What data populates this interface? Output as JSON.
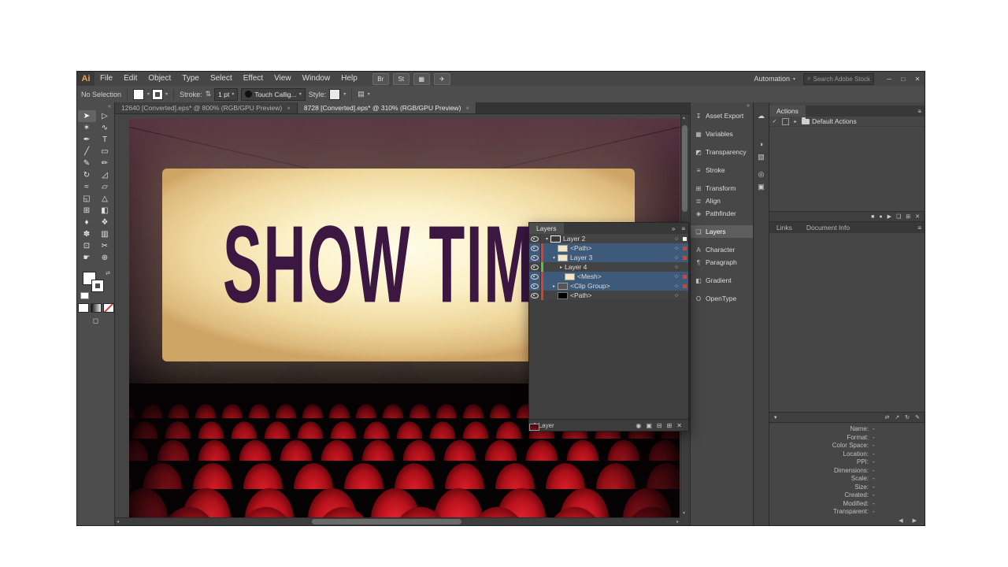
{
  "ui": {
    "caret": "▾",
    "collapse_left": "«",
    "collapse_right": "»",
    "panel_menu": "≡",
    "target": "○",
    "up": "▴",
    "down": "▾",
    "left": "◂",
    "right": "▸",
    "swap": "⇄",
    "stepper": "⇅",
    "search_glyph": "⊕"
  },
  "window": {
    "logo": "Ai",
    "menus": [
      {
        "label": "File"
      },
      {
        "label": "Edit"
      },
      {
        "label": "Object"
      },
      {
        "label": "Type"
      },
      {
        "label": "Select"
      },
      {
        "label": "Effect"
      },
      {
        "label": "View"
      },
      {
        "label": "Window"
      },
      {
        "label": "Help"
      }
    ],
    "menubar_icons": [
      {
        "name": "bridge-icon",
        "glyph": "Br"
      },
      {
        "name": "stock-icon",
        "glyph": "St"
      },
      {
        "name": "arrange-documents-icon",
        "glyph": "▦"
      },
      {
        "name": "gpu-performance-icon",
        "glyph": "✈"
      }
    ],
    "workspace": {
      "label": "Automation"
    },
    "search": {
      "placeholder": "Search Adobe Stock"
    },
    "window_controls": [
      {
        "name": "minimize-button",
        "glyph": "─"
      },
      {
        "name": "restore-button",
        "glyph": "□"
      },
      {
        "name": "close-button",
        "glyph": "✕"
      }
    ]
  },
  "control_bar": {
    "selection_status": "No Selection",
    "stroke_label": "Stroke:",
    "stroke_value": "1 pt",
    "brush_value": "Touch Callig...",
    "style_label": "Style:",
    "extra_icon": "▤"
  },
  "document_tabs": [
    {
      "label": "12640 [Converted].eps* @ 800% (RGB/GPU Preview)",
      "close": "×",
      "active": false
    },
    {
      "label": "8728 [Converted].eps* @ 310% (RGB/GPU Preview)",
      "close": "×",
      "active": true
    }
  ],
  "tools": [
    {
      "name": "selection-tool",
      "glyph": "➤",
      "active": true
    },
    {
      "name": "direct-selection-tool",
      "glyph": "▷"
    },
    {
      "name": "magic-wand-tool",
      "glyph": "✶"
    },
    {
      "name": "lasso-tool",
      "glyph": "∿"
    },
    {
      "name": "pen-tool",
      "glyph": "✒"
    },
    {
      "name": "type-tool",
      "glyph": "T"
    },
    {
      "name": "line-segment-tool",
      "glyph": "╱"
    },
    {
      "name": "rectangle-tool",
      "glyph": "▭"
    },
    {
      "name": "paintbrush-tool",
      "glyph": "✎"
    },
    {
      "name": "pencil-tool",
      "glyph": "✏"
    },
    {
      "name": "rotate-tool",
      "glyph": "↻"
    },
    {
      "name": "scale-tool",
      "glyph": "◿"
    },
    {
      "name": "width-tool",
      "glyph": "≈"
    },
    {
      "name": "free-transform-tool",
      "glyph": "▱"
    },
    {
      "name": "shape-builder-tool",
      "glyph": "◱"
    },
    {
      "name": "perspective-grid-tool",
      "glyph": "△"
    },
    {
      "name": "mesh-tool",
      "glyph": "⊞"
    },
    {
      "name": "gradient-tool",
      "glyph": "◧"
    },
    {
      "name": "eyedropper-tool",
      "glyph": "♦"
    },
    {
      "name": "blend-tool",
      "glyph": "❖"
    },
    {
      "name": "symbol-sprayer-tool",
      "glyph": "✽"
    },
    {
      "name": "column-graph-tool",
      "glyph": "▥"
    },
    {
      "name": "artboard-tool",
      "glyph": "⊡"
    },
    {
      "name": "slice-tool",
      "glyph": "✂"
    },
    {
      "name": "hand-tool",
      "glyph": "☛"
    },
    {
      "name": "zoom-tool",
      "glyph": "⊕"
    }
  ],
  "tool_footer": {
    "screen_mode_icon": "◻"
  },
  "canvas": {
    "screen_text": "SHOW TIME"
  },
  "layers_panel": {
    "tab": "Layers",
    "header_icons": [
      {
        "name": "panel-collapse-icon",
        "glyph": "»"
      },
      {
        "name": "panel-menu-icon",
        "glyph": "≡"
      }
    ],
    "rows": [
      {
        "name": "Layer 2",
        "chevron": "▾",
        "indent": 0,
        "bar": "",
        "thumb": "artboard",
        "selected": false,
        "indicator": "white"
      },
      {
        "name": "<Path>",
        "chevron": "",
        "indent": 1,
        "bar": "red",
        "thumb": "light",
        "selected": true,
        "indicator": "red"
      },
      {
        "name": "Layer 3",
        "chevron": "▾",
        "indent": 1,
        "bar": "red",
        "thumb": "light",
        "selected": true,
        "indicator": "red"
      },
      {
        "name": "Layer 4",
        "chevron": "▸",
        "indent": 2,
        "bar": "green",
        "thumb": "seats",
        "selected": false,
        "indicator": ""
      },
      {
        "name": "<Mesh>",
        "chevron": "",
        "indent": 2,
        "bar": "red",
        "thumb": "light",
        "selected": true,
        "indicator": "red"
      },
      {
        "name": "<Clip Group>",
        "chevron": "▸",
        "indent": 1,
        "bar": "red",
        "thumb": "group",
        "selected": true,
        "indicator": "red"
      },
      {
        "name": "<Path>",
        "chevron": "",
        "indent": 1,
        "bar": "red",
        "thumb": "black",
        "selected": false,
        "indicator": ""
      }
    ],
    "status": "1 Layer",
    "bottom_icons": [
      {
        "name": "locate-object-icon",
        "glyph": "◉"
      },
      {
        "name": "make-clip-mask-icon",
        "glyph": "▣"
      },
      {
        "name": "new-sublayer-icon",
        "glyph": "⊟"
      },
      {
        "name": "new-layer-icon",
        "glyph": "⊞"
      },
      {
        "name": "delete-layer-icon",
        "glyph": "✕"
      }
    ]
  },
  "right_dock": {
    "panel_buttons": [
      {
        "name": "panel-button-asset-export",
        "label": "Asset Export",
        "glyph": "↧"
      },
      {
        "name": "panel-button-variables",
        "label": "Variables",
        "glyph": "▦",
        "gap": true
      },
      {
        "name": "panel-button-transparency",
        "label": "Transparency",
        "glyph": "◩",
        "gap": true
      },
      {
        "name": "panel-button-stroke",
        "label": "Stroke",
        "glyph": "≡",
        "gap": true
      },
      {
        "name": "panel-button-transform",
        "label": "Transform",
        "glyph": "⊞",
        "gap": true
      },
      {
        "name": "panel-button-align",
        "label": "Align",
        "glyph": "≣"
      },
      {
        "name": "panel-button-pathfinder",
        "label": "Pathfinder",
        "glyph": "◈"
      },
      {
        "name": "panel-button-layers",
        "label": "Layers",
        "glyph": "❏",
        "gap": true,
        "active": true
      },
      {
        "name": "panel-button-character",
        "label": "Character",
        "glyph": "A",
        "gap": true
      },
      {
        "name": "panel-button-paragraph",
        "label": "Paragraph",
        "glyph": "¶"
      },
      {
        "name": "panel-button-gradient",
        "label": "Gradient",
        "glyph": "◧",
        "gap": true
      },
      {
        "name": "panel-button-opentype",
        "label": "OpenType",
        "glyph": "O",
        "gap": true
      }
    ],
    "strip_icons": [
      {
        "name": "cc-libraries-icon",
        "glyph": "☁"
      },
      {
        "name": "color-icon",
        "glyph": "◑",
        "gapcls": "gap-lg"
      },
      {
        "name": "color-guide-icon",
        "glyph": "▧"
      },
      {
        "name": "appearance-icon",
        "glyph": "◎",
        "gapcls": "gap-sm"
      },
      {
        "name": "graphic-styles-icon",
        "glyph": "▣"
      }
    ]
  },
  "actions_panel": {
    "tab": "Actions",
    "row": {
      "check": "✓",
      "expand": "▸",
      "label": "Default Actions"
    },
    "toolbar_icons": [
      {
        "name": "stop-icon",
        "glyph": "■"
      },
      {
        "name": "record-icon",
        "glyph": "●"
      },
      {
        "name": "play-icon",
        "glyph": "▶"
      },
      {
        "name": "new-set-icon",
        "glyph": "❏"
      },
      {
        "name": "new-action-icon",
        "glyph": "⊞"
      },
      {
        "name": "delete-action-icon",
        "glyph": "✕"
      }
    ]
  },
  "links_panel": {
    "tabs": [
      {
        "label": "Links",
        "active": true
      },
      {
        "label": "Document Info"
      }
    ],
    "toolbar": {
      "expand_icon": "▾",
      "icons": [
        {
          "name": "relink-icon",
          "glyph": "⇄"
        },
        {
          "name": "go-to-link-icon",
          "glyph": "↗"
        },
        {
          "name": "update-link-icon",
          "glyph": "↻"
        },
        {
          "name": "edit-original-icon",
          "glyph": "✎"
        }
      ]
    },
    "fields": [
      {
        "label": "Name:",
        "value": "-"
      },
      {
        "label": "Format:",
        "value": "-"
      },
      {
        "label": "Color Space:",
        "value": "-"
      },
      {
        "label": "Location:",
        "value": "-"
      },
      {
        "label": "PPI:",
        "value": "-"
      },
      {
        "label": "Dimensions:",
        "value": "-"
      },
      {
        "label": "Scale:",
        "value": "-"
      },
      {
        "label": "Size:",
        "value": "-"
      },
      {
        "label": "Created:",
        "value": "-"
      },
      {
        "label": "Modified:",
        "value": "-"
      },
      {
        "label": "Transparent:",
        "value": "-"
      }
    ],
    "nav_icons": [
      {
        "name": "prev-link-icon",
        "glyph": "◀"
      },
      {
        "name": "next-link-icon",
        "glyph": "▶"
      }
    ]
  },
  "colors": {
    "selection_blue": "#3d5a7a",
    "layer_red": "#d9402f",
    "layer_green": "#5abf4a",
    "accent_amber": "#e8a34f"
  }
}
